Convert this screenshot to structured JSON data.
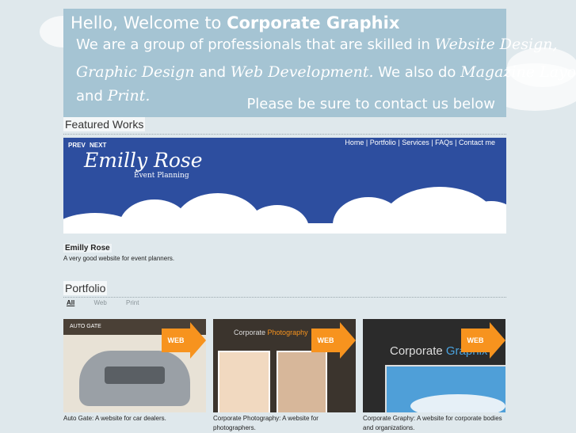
{
  "hero": {
    "greeting": "Hello, Welcome to",
    "company": "Corporate Graphix",
    "line2_a": "We are a group of professionals that are skilled in",
    "line2_b": "Website Design,",
    "line3_a": "Graphic Design",
    "line3_b": "and",
    "line3_c": "Web Development.",
    "line3_d": "We also do",
    "line3_e": "Magazine Layouts",
    "line4_a": "and",
    "line4_b": "Print.",
    "cta": "Please be sure to contact us below"
  },
  "featured": {
    "heading": "Featured Works",
    "prev": "PREV",
    "next": "NEXT",
    "menu": [
      "Home",
      "Portfolio",
      "Services",
      "FAQs",
      "Contact me"
    ],
    "separator": "|",
    "brand": "Emilly Rose",
    "brand_sub": "Event Planning",
    "title": "Emilly Rose",
    "description": "A very good website for event planners."
  },
  "portfolio": {
    "heading": "Portfolio",
    "filters": [
      "All",
      "Web",
      "Print"
    ],
    "active_filter": "All",
    "items": [
      {
        "badge": "WEB",
        "thumb_title": "AUTO GATE",
        "caption": "Auto Gate: A website for car dealers."
      },
      {
        "badge": "WEB",
        "thumb_title_a": "Corporate",
        "thumb_title_b": "Photography",
        "caption": "Corporate Photography: A website for photographers."
      },
      {
        "badge": "WEB",
        "thumb_title_a": "Corporate",
        "thumb_title_b": "Graphix",
        "caption": "Corporate Graphy: A website for corporate bodies and organizations."
      }
    ]
  },
  "colors": {
    "accent": "#f7931e",
    "banner": "#a5c4d3",
    "slider": "#2d4e9f",
    "page": "#dfe8ec"
  }
}
